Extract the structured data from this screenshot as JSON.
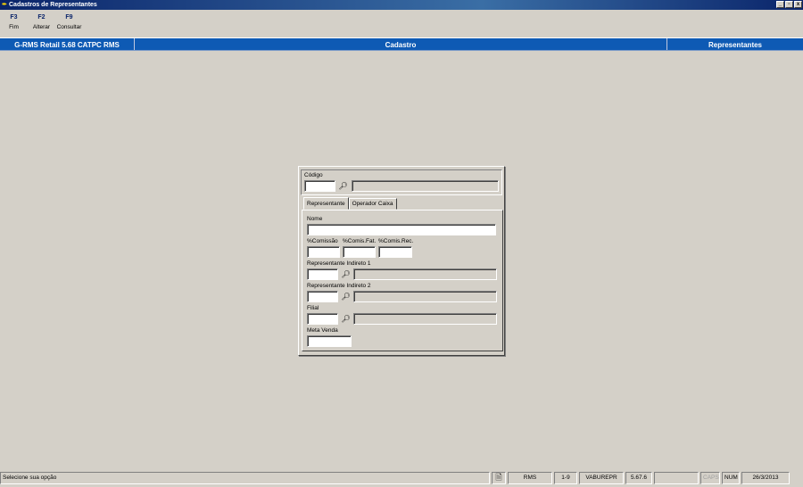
{
  "window": {
    "title": "Cadastros de Representantes",
    "controls": [
      "_",
      "▫",
      "x"
    ]
  },
  "function_keys": [
    {
      "key": "F3",
      "label": "Fim"
    },
    {
      "key": "F2",
      "label": "Alterar"
    },
    {
      "key": "F9",
      "label": "Consultar"
    }
  ],
  "header_bar": {
    "system": "G-RMS Retail 5.68 CATPC RMS",
    "section": "Cadastro",
    "entity": "Representantes"
  },
  "form": {
    "codigo_label": "Código",
    "codigo_value": "",
    "codigo_desc": "",
    "tabs": [
      "Representante",
      "Operador Caixa"
    ],
    "active_tab": "Representante",
    "nome_label": "Nome",
    "nome_value": "",
    "comissao_label": "%Comissão",
    "comis_fat_label": "%Comis.Fat.",
    "comis_rec_label": "%Comis.Rec.",
    "comissao_value": "",
    "comis_fat_value": "",
    "comis_rec_value": "",
    "rep_ind1_label": "Representante Indireto 1",
    "rep_ind2_label": "Representante Indireto 2",
    "filial_label": "Filial",
    "meta_label": "Meta Venda",
    "meta_value": "",
    "search_icon": "binoculars-icon"
  },
  "status_bar": {
    "message": "Selecione sua opção",
    "doc_icon": "document-icon",
    "system": "RMS",
    "range": "1-9",
    "program": "VABUREPR",
    "version": "5.67.6",
    "empty": "",
    "caps": "CAPS",
    "num": "NUM",
    "date": "26/3/2013"
  }
}
